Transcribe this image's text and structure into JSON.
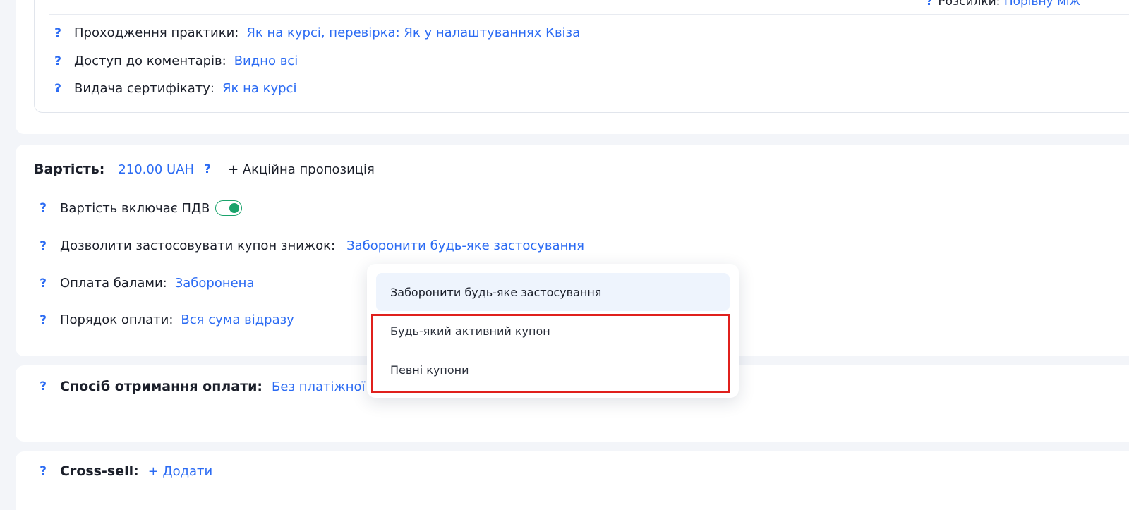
{
  "top_card": {
    "clipped_label": "Розсилки:",
    "clipped_value": "Порівну між",
    "practice": {
      "label": "Проходження практики:",
      "value": "Як на курсі, перевірка: Як у налаштуваннях Квіза"
    },
    "comments": {
      "label": "Доступ до коментарів:",
      "value": "Видно всі"
    },
    "certificate": {
      "label": "Видача сертифікату:",
      "value": "Як на курсі"
    }
  },
  "price_card": {
    "cost_label": "Вартість:",
    "cost_value": "210.00 UAH",
    "promo_label": "+ Акційна пропозиція",
    "vat_label": "Вартість включає ПДВ",
    "vat_enabled": true,
    "coupon_label": "Дозволити застосовувати купон знижок:",
    "coupon_value": "Заборонити будь-яке застосування",
    "points_label": "Оплата балами:",
    "points_value": "Заборонена",
    "order_label": "Порядок оплати:",
    "order_value": "Вся сума відразу"
  },
  "payment_card": {
    "label": "Спосіб отримання оплати:",
    "value": "Без платіжної сист"
  },
  "cross_card": {
    "label": "Cross-sell:",
    "add_label": "+ Додати"
  },
  "dropdown": {
    "selected": "Заборонити будь-яке застосування",
    "options": [
      "Заборонити будь-яке застосування",
      "Будь-який активний купон",
      "Певні купони"
    ]
  },
  "help_icon": "?",
  "colors": {
    "accent": "#2b6bf3",
    "toggle_on": "#1aa36b",
    "highlight": "#e0201c",
    "selected_bg": "#eef4fd"
  }
}
